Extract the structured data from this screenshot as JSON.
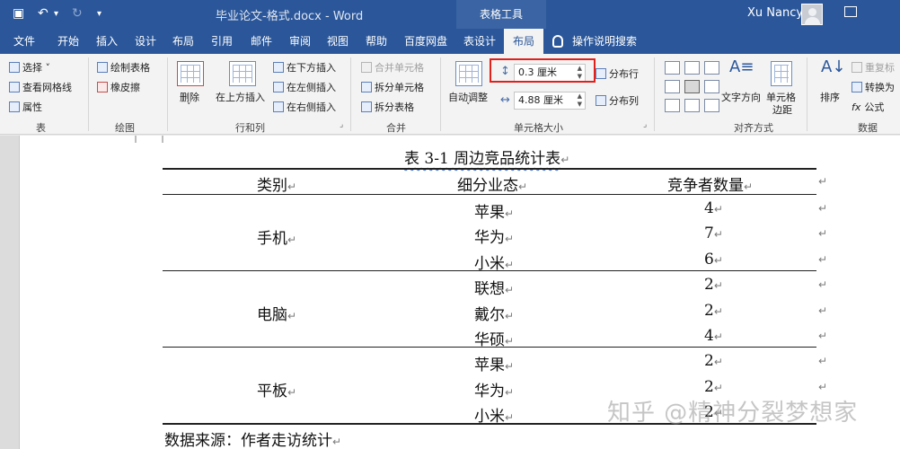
{
  "titlebar": {
    "doc_title": "毕业论文-格式.docx  -  Word",
    "context_tab": "表格工具",
    "user": "Xu Nancy"
  },
  "tabs": [
    "文件",
    "开始",
    "插入",
    "设计",
    "布局",
    "引用",
    "邮件",
    "审阅",
    "视图",
    "帮助",
    "百度网盘",
    "表设计",
    "布局"
  ],
  "active_tab_index": 12,
  "tell_me": "操作说明搜索",
  "ribbon": {
    "table": {
      "select": "选择 ˅",
      "gridlines": "查看网格线",
      "properties": "属性",
      "label": "表"
    },
    "draw": {
      "draw_table": "绘制表格",
      "eraser": "橡皮擦",
      "label": "绘图"
    },
    "rows_cols": {
      "delete": "删除",
      "insert_above": "在上方插入",
      "insert_below": "在下方插入",
      "insert_left": "在左侧插入",
      "insert_right": "在右侧插入",
      "label": "行和列"
    },
    "merge": {
      "merge_cells": "合并单元格",
      "split_cells": "拆分单元格",
      "split_table": "拆分表格",
      "label": "合并"
    },
    "cell_size": {
      "autofit": "自动调整",
      "height": "0.3 厘米",
      "width": "4.88 厘米",
      "distribute_rows": "分布行",
      "distribute_cols": "分布列",
      "label": "单元格大小"
    },
    "alignment": {
      "text_direction": "文字方向",
      "cell_margins": "单元格边距",
      "cell_margins_line2": "边距",
      "cell_margins_line1": "单元格",
      "label": "对齐方式"
    },
    "data": {
      "sort": "排序",
      "repeat_header": "重复标",
      "convert": "转换为",
      "formula": "公式",
      "label": "数据"
    }
  },
  "document": {
    "caption": "表 3-1    周边竞品统计表",
    "headers": [
      "类别",
      "细分业态",
      "竞争者数量"
    ],
    "groups": [
      {
        "category": "手机",
        "rows": [
          {
            "brand": "苹果",
            "count": "4"
          },
          {
            "brand": "华为",
            "count": "7"
          },
          {
            "brand": "小米",
            "count": "6"
          }
        ]
      },
      {
        "category": "电脑",
        "rows": [
          {
            "brand": "联想",
            "count": "2"
          },
          {
            "brand": "戴尔",
            "count": "2"
          },
          {
            "brand": "华硕",
            "count": "4"
          }
        ]
      },
      {
        "category": "平板",
        "rows": [
          {
            "brand": "苹果",
            "count": "2"
          },
          {
            "brand": "华为",
            "count": "2"
          },
          {
            "brand": "小米",
            "count": "2"
          }
        ]
      }
    ],
    "source": "数据来源：作者走访统计",
    "mark": "↵"
  },
  "watermark": "知乎 @精神分裂梦想家"
}
